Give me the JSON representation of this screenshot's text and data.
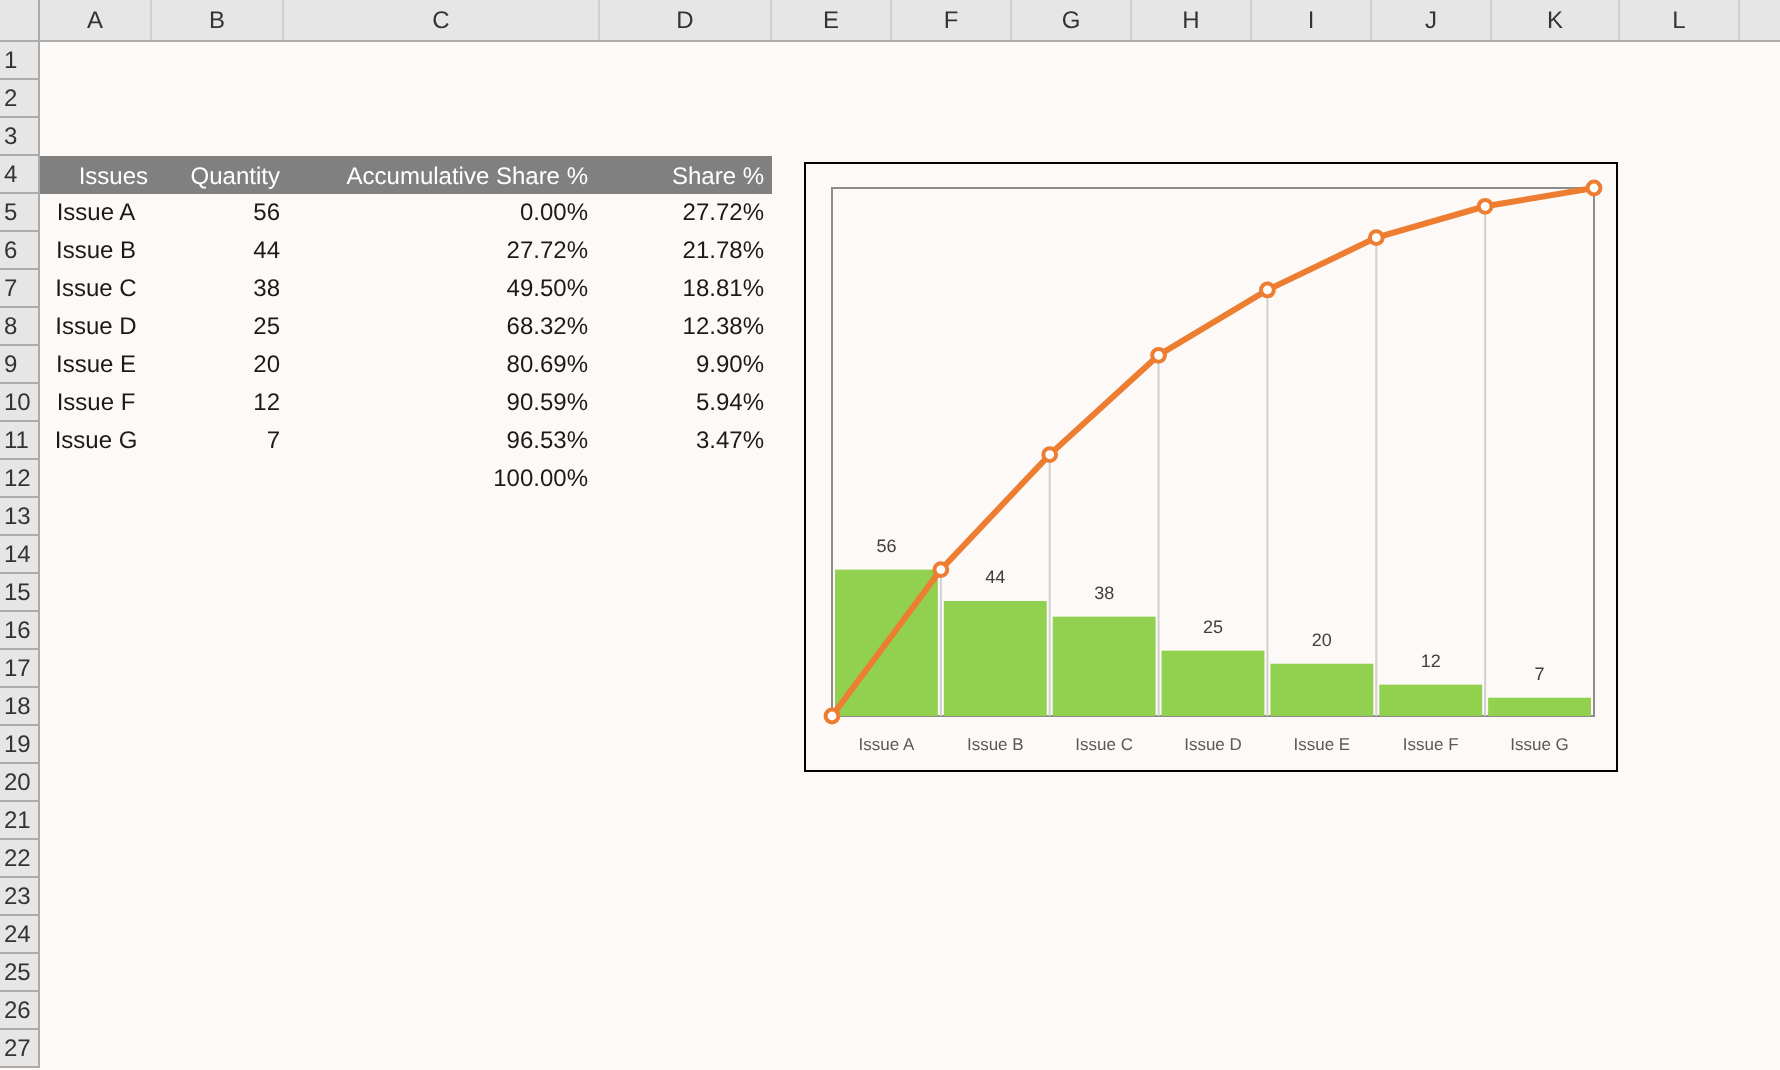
{
  "sheet": {
    "column_headers": [
      "A",
      "B",
      "C",
      "D",
      "E",
      "F",
      "G",
      "H",
      "I",
      "J",
      "K",
      "L"
    ],
    "row_headers": [
      "1",
      "2",
      "3",
      "4",
      "5",
      "6",
      "7",
      "8",
      "9",
      "10",
      "11",
      "12",
      "13",
      "14",
      "15",
      "16",
      "17",
      "18",
      "19",
      "20",
      "21",
      "22",
      "23",
      "24",
      "25",
      "26",
      "27"
    ]
  },
  "table": {
    "columns": [
      "Issues",
      "Quantity",
      "Accumulative Share %",
      "Share %"
    ],
    "rows": [
      {
        "issue": "Issue A",
        "quantity": "56",
        "accumulative_share": "0.00%",
        "share": "27.72%"
      },
      {
        "issue": "Issue B",
        "quantity": "44",
        "accumulative_share": "27.72%",
        "share": "21.78%"
      },
      {
        "issue": "Issue C",
        "quantity": "38",
        "accumulative_share": "49.50%",
        "share": "18.81%"
      },
      {
        "issue": "Issue D",
        "quantity": "25",
        "accumulative_share": "68.32%",
        "share": "12.38%"
      },
      {
        "issue": "Issue E",
        "quantity": "20",
        "accumulative_share": "80.69%",
        "share": "9.90%"
      },
      {
        "issue": "Issue F",
        "quantity": "12",
        "accumulative_share": "90.59%",
        "share": "5.94%"
      },
      {
        "issue": "Issue G",
        "quantity": "7",
        "accumulative_share": "96.53%",
        "share": "3.47%"
      },
      {
        "accumulative_share": "100.00%"
      }
    ]
  },
  "chart": {
    "chart_data": {
      "type": "bar",
      "categories": [
        "Issue A",
        "Issue B",
        "Issue C",
        "Issue D",
        "Issue E",
        "Issue F",
        "Issue G"
      ],
      "series": [
        {
          "color": "#92d050",
          "values": [
            56,
            44,
            38,
            25,
            20,
            12,
            7
          ]
        }
      ],
      "data_labels": true
    }
  }
}
